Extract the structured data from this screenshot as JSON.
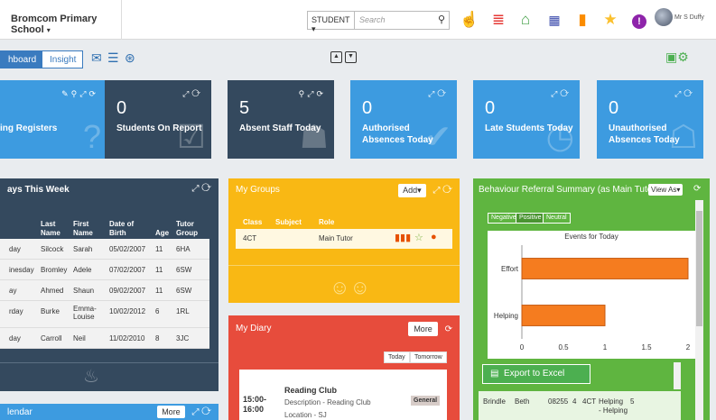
{
  "topbar": {
    "school": "Bromcom Primary School",
    "search_type": "STUDENT",
    "search_placeholder": "Search",
    "user_name": "Mr S Duffy"
  },
  "tabs": {
    "active": "hboard",
    "inactive": "Insight"
  },
  "colors": {
    "blue": "#3d9be0",
    "dark": "#34495e",
    "yellow": "#f9b814",
    "red": "#e74c3c",
    "green": "#5fb540"
  },
  "tiles": [
    {
      "label": "ing Registers",
      "value": "",
      "color": "blue"
    },
    {
      "label": "Students On Report",
      "value": "0",
      "color": "dark"
    },
    {
      "label": "Absent Staff Today",
      "value": "5",
      "color": "dark"
    },
    {
      "label": "Authorised Absences Today",
      "value": "0",
      "color": "blue"
    },
    {
      "label": "Late Students Today",
      "value": "0",
      "color": "blue"
    },
    {
      "label": "Unauthorised Absences Today",
      "value": "0",
      "color": "blue"
    }
  ],
  "absences": {
    "title": "ays This Week",
    "headers": [
      "",
      "Last Name",
      "First Name",
      "Date of Birth",
      "Age",
      "Tutor Group"
    ],
    "rows": [
      [
        "day",
        "Silcock",
        "Sarah",
        "05/02/2007",
        "11",
        "6HA"
      ],
      [
        "inesday",
        "Bromley",
        "Adele",
        "07/02/2007",
        "11",
        "6SW"
      ],
      [
        "ay",
        "Ahmed",
        "Shaun",
        "09/02/2007",
        "11",
        "6SW"
      ],
      [
        "rday",
        "Burke",
        "Emma-Louise",
        "10/02/2012",
        "6",
        "1RL"
      ],
      [
        "day",
        "Carroll",
        "Neil",
        "11/02/2010",
        "8",
        "3JC"
      ]
    ]
  },
  "groups": {
    "title": "My Groups",
    "add_label": "Add",
    "headers": [
      "Class",
      "Subject",
      "Role"
    ],
    "row": [
      "4CT",
      "",
      "Main Tutor"
    ]
  },
  "diary": {
    "title": "My Diary",
    "more_label": "More",
    "today": "Today",
    "tomorrow": "Tomorrow",
    "event_time": "15:00- 16:00",
    "event_title": "Reading Club",
    "event_desc": "Description - Reading Club",
    "event_loc": "Location - SJ",
    "event_tag": "General"
  },
  "behaviour": {
    "title": "Behaviour Referral Summary (as Main Tutor)",
    "view_as": "View As",
    "tabs": [
      "Negative",
      "Positive",
      "Neutral"
    ],
    "excel": "Export to Excel",
    "row": [
      "Brindle",
      "Beth",
      "08255",
      "4",
      "4CT",
      "Helping",
      "5",
      "- Helping"
    ]
  },
  "calendar": {
    "title": "lendar",
    "more_label": "More"
  },
  "chart_data": {
    "type": "bar",
    "orientation": "horizontal",
    "title": "Events for Today",
    "categories": [
      "Effort",
      "Helping"
    ],
    "values": [
      2,
      1
    ],
    "xlim": [
      0,
      2
    ],
    "xticks": [
      "0",
      "0.5",
      "1",
      "1.5",
      "2"
    ],
    "bar_color": "#f57c1f"
  }
}
